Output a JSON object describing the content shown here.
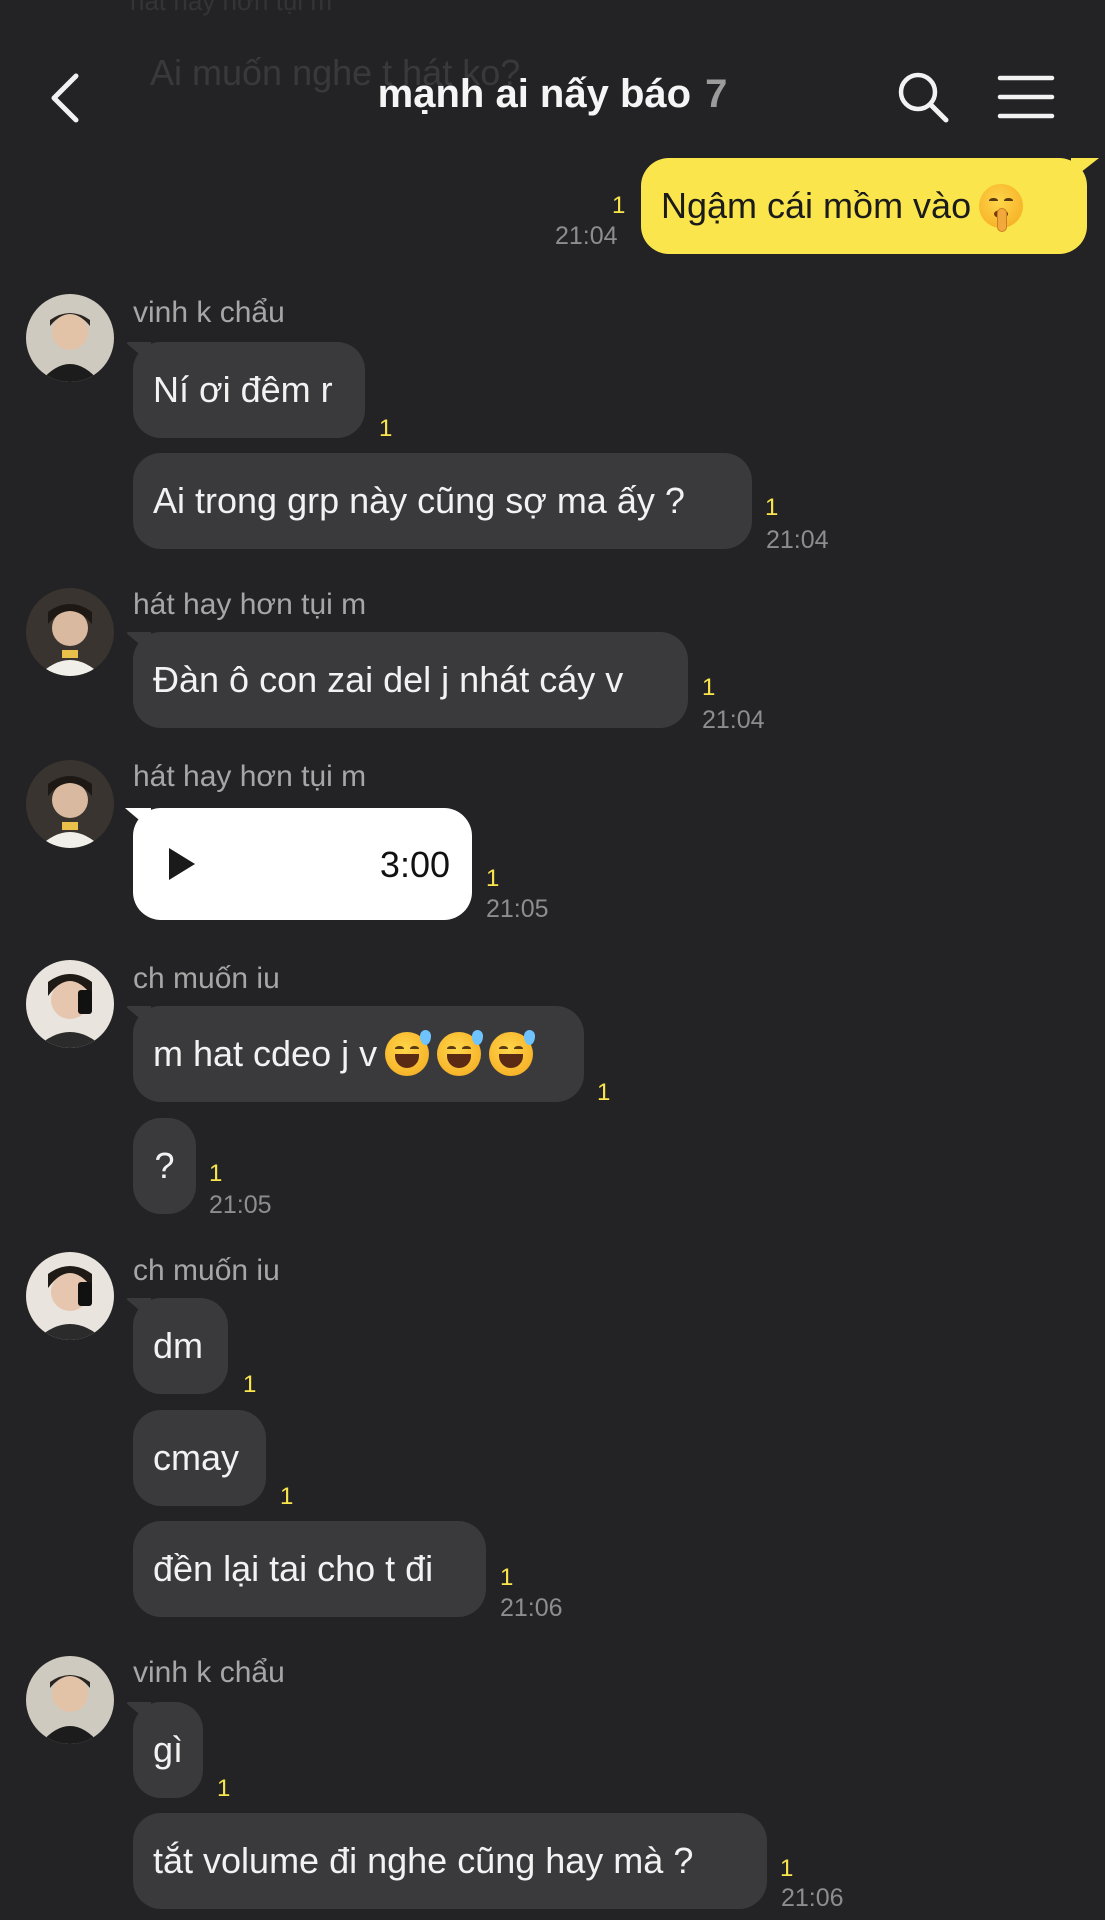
{
  "header": {
    "title": "mạnh ai nấy báo",
    "member_count": "7",
    "ghost_text": "Ai muốn nghe t hát ko?",
    "ghost_sender": "hát hay hơn tụi m",
    "icons": {
      "back": "chevron-left-icon",
      "search": "search-icon",
      "menu": "hamburger-menu-icon"
    }
  },
  "colors": {
    "background": "#232325",
    "bubble_other": "#3a3a3d",
    "bubble_mine": "#fae54c",
    "unread": "#fae54c"
  },
  "messages": [
    {
      "id": "m1",
      "mine": true,
      "text": "Ngậm cái mồm vào",
      "emoji": "shushing-face",
      "unread": "1",
      "time": "21:04"
    },
    {
      "id": "g1",
      "sender": "vinh k chẩu",
      "items": [
        {
          "text": "Ní ơi đêm r",
          "unread": "1"
        },
        {
          "text": "Ai trong grp này cũng sợ ma ấy ?",
          "unread": "1",
          "time": "21:04"
        }
      ]
    },
    {
      "id": "g2",
      "sender": "hát hay hơn tụi m",
      "items": [
        {
          "text": "Đàn ô con zai del j nhát cáy v",
          "unread": "1",
          "time": "21:04"
        }
      ]
    },
    {
      "id": "g3",
      "sender": "hát hay hơn tụi m",
      "items": [
        {
          "voice_duration": "3:00",
          "unread": "1",
          "time": "21:05"
        }
      ]
    },
    {
      "id": "g4",
      "sender": "ch muốn iu",
      "items": [
        {
          "text": "m hat cdeo j v",
          "emoji": "grinning-sweat-face x3",
          "unread": "1"
        },
        {
          "text": "?",
          "unread": "1",
          "time": "21:05"
        }
      ]
    },
    {
      "id": "g5",
      "sender": "ch muốn iu",
      "items": [
        {
          "text": "dm",
          "unread": "1"
        },
        {
          "text": "cmay",
          "unread": "1"
        },
        {
          "text": "đền lại tai cho t đi",
          "unread": "1",
          "time": "21:06"
        }
      ]
    },
    {
      "id": "g6",
      "sender": "vinh k chẩu",
      "items": [
        {
          "text": "gì",
          "unread": "1"
        },
        {
          "text": "tắt volume đi nghe cũng hay mà ?",
          "unread": "1",
          "time": "21:06"
        }
      ]
    }
  ]
}
